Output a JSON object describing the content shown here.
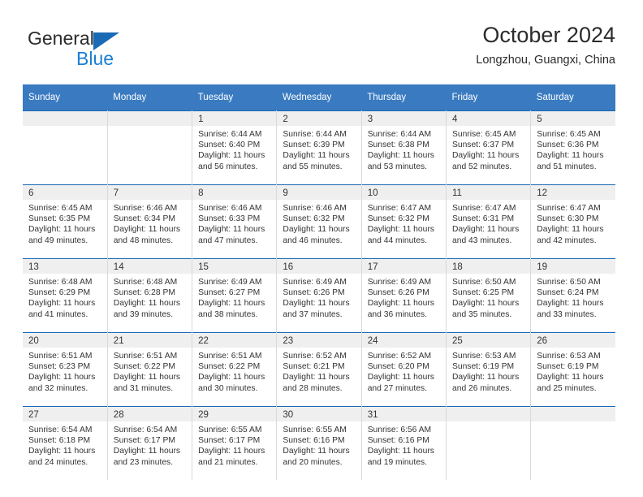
{
  "brand": {
    "name_top": "General",
    "name_bottom": "Blue",
    "triangle_color": "#1a6ab5",
    "blue_color": "#1a7fd4"
  },
  "header": {
    "title": "October 2024",
    "subtitle": "Longzhou, Guangxi, China"
  },
  "theme": {
    "header_bg": "#3a7ac0",
    "row_rule": "#1a6ab5",
    "daynum_bg": "#efefef",
    "text": "#333333"
  },
  "calendar": {
    "weekday_headers": [
      "Sunday",
      "Monday",
      "Tuesday",
      "Wednesday",
      "Thursday",
      "Friday",
      "Saturday"
    ],
    "weeks": [
      [
        {
          "day": "",
          "sunrise": "",
          "sunset": "",
          "daylight_line1": "",
          "daylight_line2": ""
        },
        {
          "day": "",
          "sunrise": "",
          "sunset": "",
          "daylight_line1": "",
          "daylight_line2": ""
        },
        {
          "day": "1",
          "sunrise": "Sunrise: 6:44 AM",
          "sunset": "Sunset: 6:40 PM",
          "daylight_line1": "Daylight: 11 hours",
          "daylight_line2": "and 56 minutes."
        },
        {
          "day": "2",
          "sunrise": "Sunrise: 6:44 AM",
          "sunset": "Sunset: 6:39 PM",
          "daylight_line1": "Daylight: 11 hours",
          "daylight_line2": "and 55 minutes."
        },
        {
          "day": "3",
          "sunrise": "Sunrise: 6:44 AM",
          "sunset": "Sunset: 6:38 PM",
          "daylight_line1": "Daylight: 11 hours",
          "daylight_line2": "and 53 minutes."
        },
        {
          "day": "4",
          "sunrise": "Sunrise: 6:45 AM",
          "sunset": "Sunset: 6:37 PM",
          "daylight_line1": "Daylight: 11 hours",
          "daylight_line2": "and 52 minutes."
        },
        {
          "day": "5",
          "sunrise": "Sunrise: 6:45 AM",
          "sunset": "Sunset: 6:36 PM",
          "daylight_line1": "Daylight: 11 hours",
          "daylight_line2": "and 51 minutes."
        }
      ],
      [
        {
          "day": "6",
          "sunrise": "Sunrise: 6:45 AM",
          "sunset": "Sunset: 6:35 PM",
          "daylight_line1": "Daylight: 11 hours",
          "daylight_line2": "and 49 minutes."
        },
        {
          "day": "7",
          "sunrise": "Sunrise: 6:46 AM",
          "sunset": "Sunset: 6:34 PM",
          "daylight_line1": "Daylight: 11 hours",
          "daylight_line2": "and 48 minutes."
        },
        {
          "day": "8",
          "sunrise": "Sunrise: 6:46 AM",
          "sunset": "Sunset: 6:33 PM",
          "daylight_line1": "Daylight: 11 hours",
          "daylight_line2": "and 47 minutes."
        },
        {
          "day": "9",
          "sunrise": "Sunrise: 6:46 AM",
          "sunset": "Sunset: 6:32 PM",
          "daylight_line1": "Daylight: 11 hours",
          "daylight_line2": "and 46 minutes."
        },
        {
          "day": "10",
          "sunrise": "Sunrise: 6:47 AM",
          "sunset": "Sunset: 6:32 PM",
          "daylight_line1": "Daylight: 11 hours",
          "daylight_line2": "and 44 minutes."
        },
        {
          "day": "11",
          "sunrise": "Sunrise: 6:47 AM",
          "sunset": "Sunset: 6:31 PM",
          "daylight_line1": "Daylight: 11 hours",
          "daylight_line2": "and 43 minutes."
        },
        {
          "day": "12",
          "sunrise": "Sunrise: 6:47 AM",
          "sunset": "Sunset: 6:30 PM",
          "daylight_line1": "Daylight: 11 hours",
          "daylight_line2": "and 42 minutes."
        }
      ],
      [
        {
          "day": "13",
          "sunrise": "Sunrise: 6:48 AM",
          "sunset": "Sunset: 6:29 PM",
          "daylight_line1": "Daylight: 11 hours",
          "daylight_line2": "and 41 minutes."
        },
        {
          "day": "14",
          "sunrise": "Sunrise: 6:48 AM",
          "sunset": "Sunset: 6:28 PM",
          "daylight_line1": "Daylight: 11 hours",
          "daylight_line2": "and 39 minutes."
        },
        {
          "day": "15",
          "sunrise": "Sunrise: 6:49 AM",
          "sunset": "Sunset: 6:27 PM",
          "daylight_line1": "Daylight: 11 hours",
          "daylight_line2": "and 38 minutes."
        },
        {
          "day": "16",
          "sunrise": "Sunrise: 6:49 AM",
          "sunset": "Sunset: 6:26 PM",
          "daylight_line1": "Daylight: 11 hours",
          "daylight_line2": "and 37 minutes."
        },
        {
          "day": "17",
          "sunrise": "Sunrise: 6:49 AM",
          "sunset": "Sunset: 6:26 PM",
          "daylight_line1": "Daylight: 11 hours",
          "daylight_line2": "and 36 minutes."
        },
        {
          "day": "18",
          "sunrise": "Sunrise: 6:50 AM",
          "sunset": "Sunset: 6:25 PM",
          "daylight_line1": "Daylight: 11 hours",
          "daylight_line2": "and 35 minutes."
        },
        {
          "day": "19",
          "sunrise": "Sunrise: 6:50 AM",
          "sunset": "Sunset: 6:24 PM",
          "daylight_line1": "Daylight: 11 hours",
          "daylight_line2": "and 33 minutes."
        }
      ],
      [
        {
          "day": "20",
          "sunrise": "Sunrise: 6:51 AM",
          "sunset": "Sunset: 6:23 PM",
          "daylight_line1": "Daylight: 11 hours",
          "daylight_line2": "and 32 minutes."
        },
        {
          "day": "21",
          "sunrise": "Sunrise: 6:51 AM",
          "sunset": "Sunset: 6:22 PM",
          "daylight_line1": "Daylight: 11 hours",
          "daylight_line2": "and 31 minutes."
        },
        {
          "day": "22",
          "sunrise": "Sunrise: 6:51 AM",
          "sunset": "Sunset: 6:22 PM",
          "daylight_line1": "Daylight: 11 hours",
          "daylight_line2": "and 30 minutes."
        },
        {
          "day": "23",
          "sunrise": "Sunrise: 6:52 AM",
          "sunset": "Sunset: 6:21 PM",
          "daylight_line1": "Daylight: 11 hours",
          "daylight_line2": "and 28 minutes."
        },
        {
          "day": "24",
          "sunrise": "Sunrise: 6:52 AM",
          "sunset": "Sunset: 6:20 PM",
          "daylight_line1": "Daylight: 11 hours",
          "daylight_line2": "and 27 minutes."
        },
        {
          "day": "25",
          "sunrise": "Sunrise: 6:53 AM",
          "sunset": "Sunset: 6:19 PM",
          "daylight_line1": "Daylight: 11 hours",
          "daylight_line2": "and 26 minutes."
        },
        {
          "day": "26",
          "sunrise": "Sunrise: 6:53 AM",
          "sunset": "Sunset: 6:19 PM",
          "daylight_line1": "Daylight: 11 hours",
          "daylight_line2": "and 25 minutes."
        }
      ],
      [
        {
          "day": "27",
          "sunrise": "Sunrise: 6:54 AM",
          "sunset": "Sunset: 6:18 PM",
          "daylight_line1": "Daylight: 11 hours",
          "daylight_line2": "and 24 minutes."
        },
        {
          "day": "28",
          "sunrise": "Sunrise: 6:54 AM",
          "sunset": "Sunset: 6:17 PM",
          "daylight_line1": "Daylight: 11 hours",
          "daylight_line2": "and 23 minutes."
        },
        {
          "day": "29",
          "sunrise": "Sunrise: 6:55 AM",
          "sunset": "Sunset: 6:17 PM",
          "daylight_line1": "Daylight: 11 hours",
          "daylight_line2": "and 21 minutes."
        },
        {
          "day": "30",
          "sunrise": "Sunrise: 6:55 AM",
          "sunset": "Sunset: 6:16 PM",
          "daylight_line1": "Daylight: 11 hours",
          "daylight_line2": "and 20 minutes."
        },
        {
          "day": "31",
          "sunrise": "Sunrise: 6:56 AM",
          "sunset": "Sunset: 6:16 PM",
          "daylight_line1": "Daylight: 11 hours",
          "daylight_line2": "and 19 minutes."
        },
        {
          "day": "",
          "sunrise": "",
          "sunset": "",
          "daylight_line1": "",
          "daylight_line2": ""
        },
        {
          "day": "",
          "sunrise": "",
          "sunset": "",
          "daylight_line1": "",
          "daylight_line2": ""
        }
      ]
    ]
  }
}
